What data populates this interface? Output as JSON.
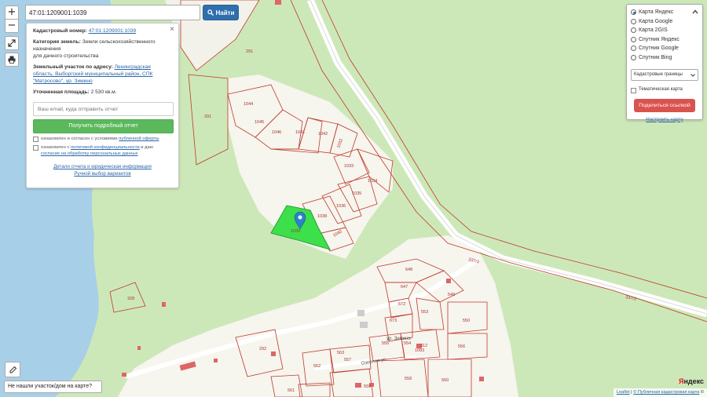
{
  "search": {
    "value": "47:01:1209001:1039",
    "button_label": "Найти"
  },
  "zoom": {
    "in": "+",
    "out": "−"
  },
  "info": {
    "cadastral_label": "Кадастровый номер:",
    "cadastral_value": "47:01:1209001:1039",
    "category_label": "Категория земель:",
    "category_value": "Земли сельскохозяйственного назначения",
    "usage_value": "для дачного строительства",
    "address_label": "Земельный участок по адресу:",
    "address_value": "Ленинградская область, Выборгский муниципальный район, СПК \"Матросово\", ур. Зимино",
    "area_label": "Уточненная площадь:",
    "area_value": "2 530 кв.м.",
    "email_placeholder": "Ваш email, куда отправить отчет",
    "report_button": "Получить подробный отчет",
    "agree1_prefix": "ознакомлен и согласен с условиями",
    "agree1_link": "публичной оферты",
    "agree2_prefix": "ознакомлен с",
    "agree2_link": "политикой конфиденциальности",
    "agree2_mid": "и даю",
    "agree2_link2": "согласие на обработку персональных данных",
    "details_link": "Детали отчета и юридическая информация",
    "manual_link": "Ручной выбор вариантов",
    "close": "×"
  },
  "layers": {
    "options": [
      "Карта Яндекс",
      "Карта Google",
      "Карта 2GIS",
      "Спутник Яндекс",
      "Спутник Google",
      "Спутник Bing"
    ],
    "selected": 0,
    "select_value": "Кадастровые границы",
    "thematic_label": "Тематическая карта",
    "share_button": "Поделиться ссылкой",
    "configure_link": "Настроить карту"
  },
  "missing_button": "Не нашли участок/дом на карте?",
  "attribution": {
    "leaflet": "Leaflet",
    "sep": " | ",
    "source": "© Публичная кадастровая карта",
    "extra": "© "
  },
  "yandex_logo": {
    "first": "Я",
    "rest": "ндекс"
  },
  "map": {
    "colors": {
      "water": "#a8cfe8",
      "land": "#cde8b8",
      "clear": "#f6f5ee",
      "parcel_line": "#c0392b",
      "selected": "#3ce04a",
      "marker": "#2a82c9"
    },
    "parcel_numbers": [
      "291",
      "291",
      "1044",
      "1045",
      "1046",
      "1041",
      "1042",
      "1032",
      "1033",
      "1034",
      "1035",
      "1036",
      "1038",
      "1040",
      "1039",
      "328",
      "648",
      "647",
      "672",
      "549",
      "553",
      "673",
      "550",
      "555",
      "554",
      "556",
      "292",
      "563",
      "562",
      "557",
      "558",
      "559",
      "561",
      "560",
      "312",
      "1083"
    ],
    "road_labels": [
      "337/3",
      "337/3",
      "ур. Зимино",
      "Озерная ул."
    ]
  }
}
